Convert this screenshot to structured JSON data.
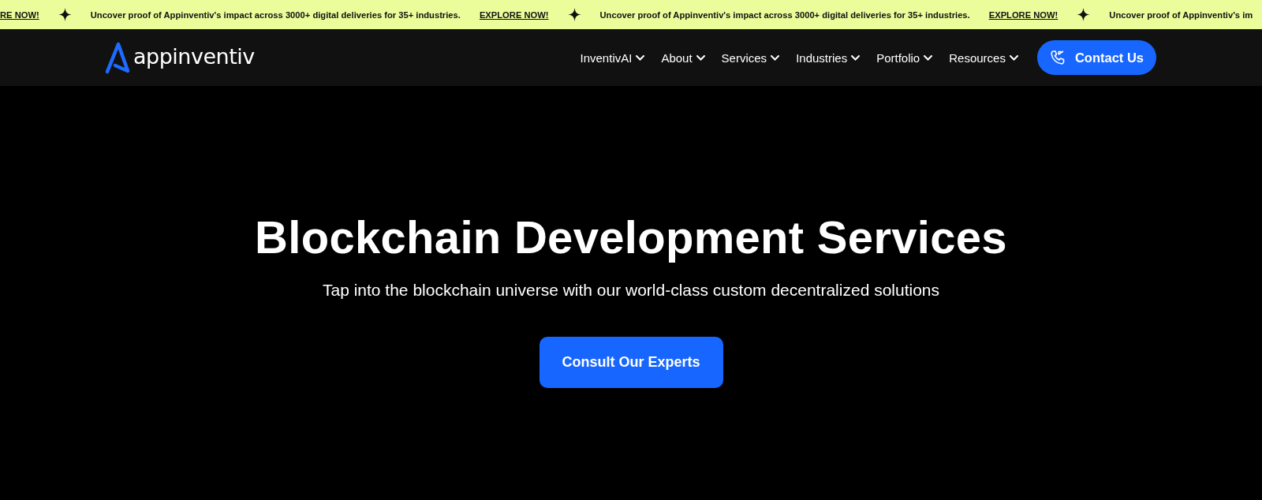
{
  "ticker": [
    {
      "kind": "link",
      "text": "RE NOW!"
    },
    {
      "kind": "star"
    },
    {
      "kind": "message",
      "text": "Uncover proof of Appinventiv's impact across 3000+ digital deliveries for 35+ industries."
    },
    {
      "kind": "link",
      "text": "EXPLORE NOW!"
    },
    {
      "kind": "star"
    },
    {
      "kind": "message",
      "text": "Uncover proof of Appinventiv's impact across 3000+ digital deliveries for 35+ industries."
    },
    {
      "kind": "link",
      "text": "EXPLORE NOW!"
    },
    {
      "kind": "star"
    },
    {
      "kind": "message",
      "text": "Uncover proof of Appinventiv's im"
    }
  ],
  "header": {
    "logo": "appinventiv",
    "menu": [
      "InventivAI",
      "About",
      "Services",
      "Industries",
      "Portfolio",
      "Resources"
    ],
    "contact_button": "Contact Us"
  },
  "hero": {
    "title": "Blockchain Development Services",
    "subtitle": "Tap into the blockchain universe with our world-class custom decentralized solutions",
    "cta_button": "Consult Our Experts"
  }
}
